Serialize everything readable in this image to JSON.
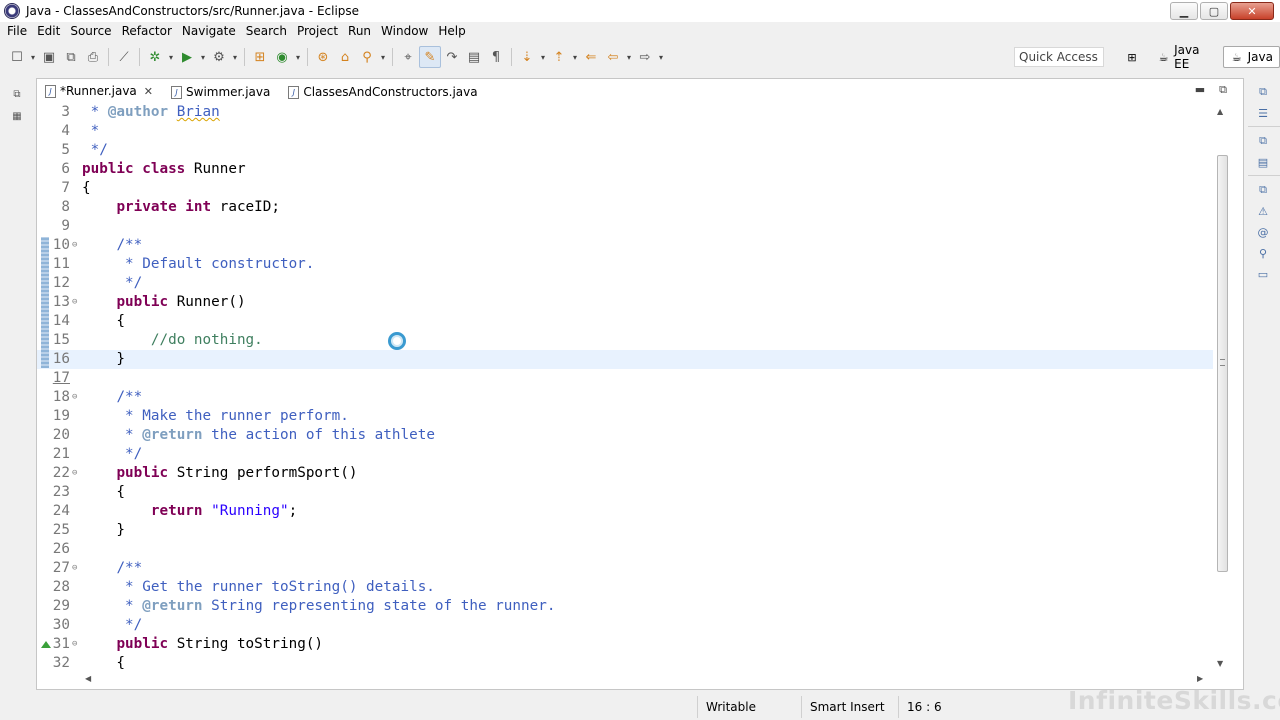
{
  "window": {
    "title": "Java - ClassesAndConstructors/src/Runner.java - Eclipse",
    "buttons": [
      "minimize",
      "maximize",
      "close"
    ]
  },
  "menu": [
    "File",
    "Edit",
    "Source",
    "Refactor",
    "Navigate",
    "Search",
    "Project",
    "Run",
    "Window",
    "Help"
  ],
  "toolbar": {
    "quick_access_placeholder": "Quick Access",
    "perspectives": [
      {
        "label": "Java EE",
        "active": false
      },
      {
        "label": "Java",
        "active": true
      }
    ]
  },
  "editor": {
    "tabs": [
      {
        "label": "*Runner.java",
        "active": true,
        "closable": true
      },
      {
        "label": "Swimmer.java",
        "active": false,
        "closable": false
      },
      {
        "label": "ClassesAndConstructors.java",
        "active": false,
        "closable": false
      }
    ],
    "current_line": 16,
    "lines": [
      {
        "n": "3",
        "fold": "",
        "html": "<span class=\"cm\"> * </span><span class=\"tag\">@author</span><span class=\"cm\"> <span class=\"squiggle\">Brian</span></span>"
      },
      {
        "n": "4",
        "fold": "",
        "html": "<span class=\"cm\"> *</span>"
      },
      {
        "n": "5",
        "fold": "",
        "html": "<span class=\"cm\"> */</span>"
      },
      {
        "n": "6",
        "fold": "",
        "html": "<span class=\"kw\">public class</span> Runner"
      },
      {
        "n": "7",
        "fold": "",
        "html": "{"
      },
      {
        "n": "8",
        "fold": "",
        "html": "    <span class=\"kw\">private int</span> raceID;"
      },
      {
        "n": "9",
        "fold": "",
        "html": ""
      },
      {
        "n": "10",
        "fold": "⊖",
        "html": "    <span class=\"cm\">/**</span>"
      },
      {
        "n": "11",
        "fold": "",
        "html": "<span class=\"cm\">     * Default constructor.</span>"
      },
      {
        "n": "12",
        "fold": "",
        "html": "<span class=\"cm\">     */</span>"
      },
      {
        "n": "13",
        "fold": "⊖",
        "html": "    <span class=\"kw\">public</span> Runner()"
      },
      {
        "n": "14",
        "fold": "",
        "html": "    {"
      },
      {
        "n": "15",
        "fold": "",
        "html": "        <span class=\"lc\">//do nothing.</span>"
      },
      {
        "n": "16",
        "fold": "",
        "html": "    }"
      },
      {
        "n": "17",
        "fold": "",
        "html": ""
      },
      {
        "n": "18",
        "fold": "⊖",
        "html": "    <span class=\"cm\">/**</span>"
      },
      {
        "n": "19",
        "fold": "",
        "html": "<span class=\"cm\">     * Make the runner perform.</span>"
      },
      {
        "n": "20",
        "fold": "",
        "html": "<span class=\"cm\">     * </span><span class=\"tag\">@return</span><span class=\"cm\"> the action of this athlete</span>"
      },
      {
        "n": "21",
        "fold": "",
        "html": "<span class=\"cm\">     */</span>"
      },
      {
        "n": "22",
        "fold": "⊖",
        "html": "    <span class=\"kw\">public</span> String performSport()"
      },
      {
        "n": "23",
        "fold": "",
        "html": "    {"
      },
      {
        "n": "24",
        "fold": "",
        "html": "        <span class=\"kw\">return</span> <span class=\"str\">\"Running\"</span>;"
      },
      {
        "n": "25",
        "fold": "",
        "html": "    }"
      },
      {
        "n": "26",
        "fold": "",
        "html": ""
      },
      {
        "n": "27",
        "fold": "⊖",
        "html": "    <span class=\"cm\">/**</span>"
      },
      {
        "n": "28",
        "fold": "",
        "html": "<span class=\"cm\">     * Get the runner toString() details.</span>"
      },
      {
        "n": "29",
        "fold": "",
        "html": "<span class=\"cm\">     * </span><span class=\"tag\">@return</span><span class=\"cm\"> String representing state of the runner.</span>"
      },
      {
        "n": "30",
        "fold": "",
        "html": "<span class=\"cm\">     */</span>"
      },
      {
        "n": "31",
        "fold": "⊖",
        "html": "    <span class=\"kw\">public</span> String toString()"
      },
      {
        "n": "32",
        "fold": "",
        "html": "    {"
      }
    ]
  },
  "status": {
    "writable": "Writable",
    "insert_mode": "Smart Insert",
    "position": "16 : 6"
  },
  "watermark": "InfiniteSkills.com",
  "colors": {
    "keyword": "#7f0055",
    "javadoc": "#3f5fbf",
    "line_comment": "#3f7f5f",
    "javadoc_tag": "#7f9fbf",
    "string": "#2a00ff",
    "current_line": "#e8f2fe"
  }
}
